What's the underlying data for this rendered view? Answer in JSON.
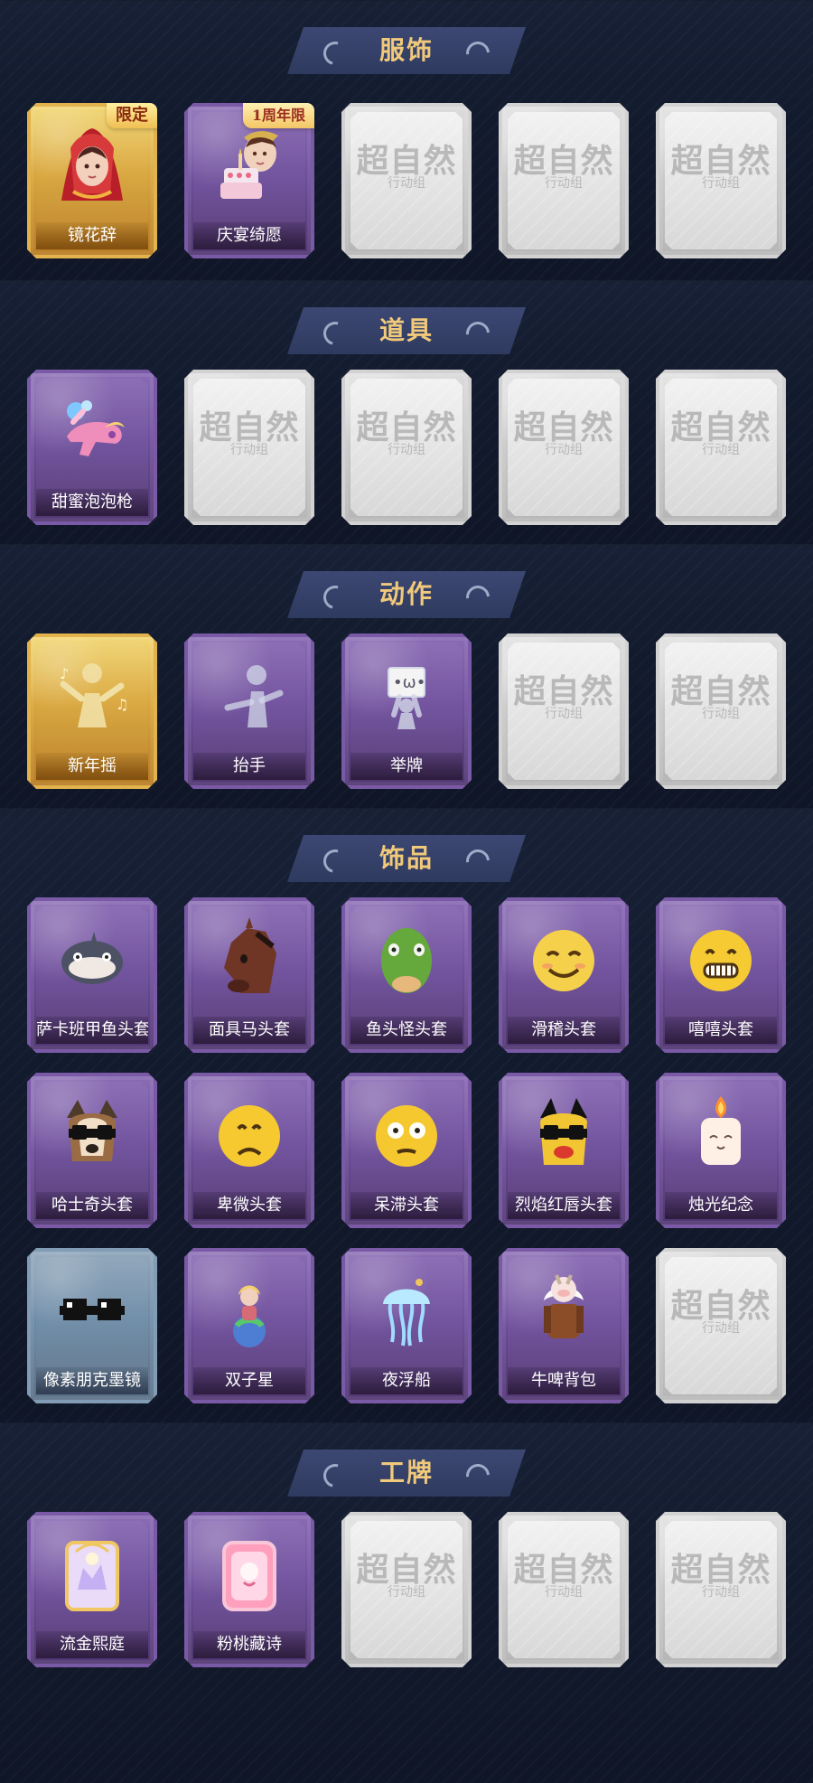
{
  "sections": [
    {
      "title": "服饰",
      "items": [
        {
          "label": "镜花辞",
          "frame": "gold",
          "icon": "red-hood-girl-icon",
          "badge": "限定"
        },
        {
          "label": "庆宴绮愿",
          "frame": "purple",
          "icon": "cake-girl-icon",
          "badge": "1周年限"
        },
        {
          "label": "",
          "frame": "placeholder",
          "icon": "supernatural-placeholder-icon",
          "placeholder_title": "超自然",
          "placeholder_sub": "行动组"
        },
        {
          "label": "",
          "frame": "placeholder",
          "icon": "supernatural-placeholder-icon",
          "placeholder_title": "超自然",
          "placeholder_sub": "行动组"
        },
        {
          "label": "",
          "frame": "placeholder",
          "icon": "supernatural-placeholder-icon",
          "placeholder_title": "超自然",
          "placeholder_sub": "行动组"
        }
      ]
    },
    {
      "title": "道具",
      "items": [
        {
          "label": "甜蜜泡泡枪",
          "frame": "purple",
          "icon": "bubble-gun-icon"
        },
        {
          "label": "",
          "frame": "placeholder",
          "icon": "supernatural-placeholder-icon",
          "placeholder_title": "超自然",
          "placeholder_sub": "行动组"
        },
        {
          "label": "",
          "frame": "placeholder",
          "icon": "supernatural-placeholder-icon",
          "placeholder_title": "超自然",
          "placeholder_sub": "行动组"
        },
        {
          "label": "",
          "frame": "placeholder",
          "icon": "supernatural-placeholder-icon",
          "placeholder_title": "超自然",
          "placeholder_sub": "行动组"
        },
        {
          "label": "",
          "frame": "placeholder",
          "icon": "supernatural-placeholder-icon",
          "placeholder_title": "超自然",
          "placeholder_sub": "行动组"
        }
      ]
    },
    {
      "title": "动作",
      "items": [
        {
          "label": "新年摇",
          "frame": "gold",
          "icon": "music-dance-icon"
        },
        {
          "label": "抬手",
          "frame": "purple",
          "icon": "raise-hand-icon"
        },
        {
          "label": "举牌",
          "frame": "purple",
          "icon": "hold-sign-icon"
        },
        {
          "label": "",
          "frame": "placeholder",
          "icon": "supernatural-placeholder-icon",
          "placeholder_title": "超自然",
          "placeholder_sub": "行动组"
        },
        {
          "label": "",
          "frame": "placeholder",
          "icon": "supernatural-placeholder-icon",
          "placeholder_title": "超自然",
          "placeholder_sub": "行动组"
        }
      ]
    },
    {
      "title": "饰品",
      "items": [
        {
          "label": "萨卡班甲鱼头套",
          "frame": "purple",
          "icon": "fish-head-icon"
        },
        {
          "label": "面具马头套",
          "frame": "purple",
          "icon": "horse-head-icon"
        },
        {
          "label": "鱼头怪头套",
          "frame": "purple",
          "icon": "green-fish-mask-icon"
        },
        {
          "label": "滑稽头套",
          "frame": "purple",
          "icon": "smile-face-icon"
        },
        {
          "label": "嘻嘻头套",
          "frame": "purple",
          "icon": "grin-face-icon"
        },
        {
          "label": "哈士奇头套",
          "frame": "purple",
          "icon": "husky-head-icon"
        },
        {
          "label": "卑微头套",
          "frame": "purple",
          "icon": "sad-face-icon"
        },
        {
          "label": "呆滞头套",
          "frame": "purple",
          "icon": "stunned-face-icon"
        },
        {
          "label": "烈焰红唇头套",
          "frame": "purple",
          "icon": "yellow-mask-glasses-icon"
        },
        {
          "label": "烛光纪念",
          "frame": "purple",
          "icon": "candle-icon"
        },
        {
          "label": "像素朋克墨镜",
          "frame": "blue",
          "icon": "pixel-sunglasses-icon"
        },
        {
          "label": "双子星",
          "frame": "purple",
          "icon": "planet-girl-icon"
        },
        {
          "label": "夜浮船",
          "frame": "purple",
          "icon": "jellyfish-icon"
        },
        {
          "label": "牛啤背包",
          "frame": "purple",
          "icon": "cow-beer-bag-icon"
        },
        {
          "label": "",
          "frame": "placeholder",
          "icon": "supernatural-placeholder-icon",
          "placeholder_title": "超自然",
          "placeholder_sub": "行动组"
        }
      ]
    },
    {
      "title": "工牌",
      "items": [
        {
          "label": "流金熙庭",
          "frame": "purple",
          "icon": "golden-badge-card-icon"
        },
        {
          "label": "粉桃藏诗",
          "frame": "purple",
          "icon": "pink-badge-card-icon"
        },
        {
          "label": "",
          "frame": "placeholder",
          "icon": "supernatural-placeholder-icon",
          "placeholder_title": "超自然",
          "placeholder_sub": "行动组"
        },
        {
          "label": "",
          "frame": "placeholder",
          "icon": "supernatural-placeholder-icon",
          "placeholder_title": "超自然",
          "placeholder_sub": "行动组"
        },
        {
          "label": "",
          "frame": "placeholder",
          "icon": "supernatural-placeholder-icon",
          "placeholder_title": "超自然",
          "placeholder_sub": "行动组"
        }
      ]
    }
  ]
}
